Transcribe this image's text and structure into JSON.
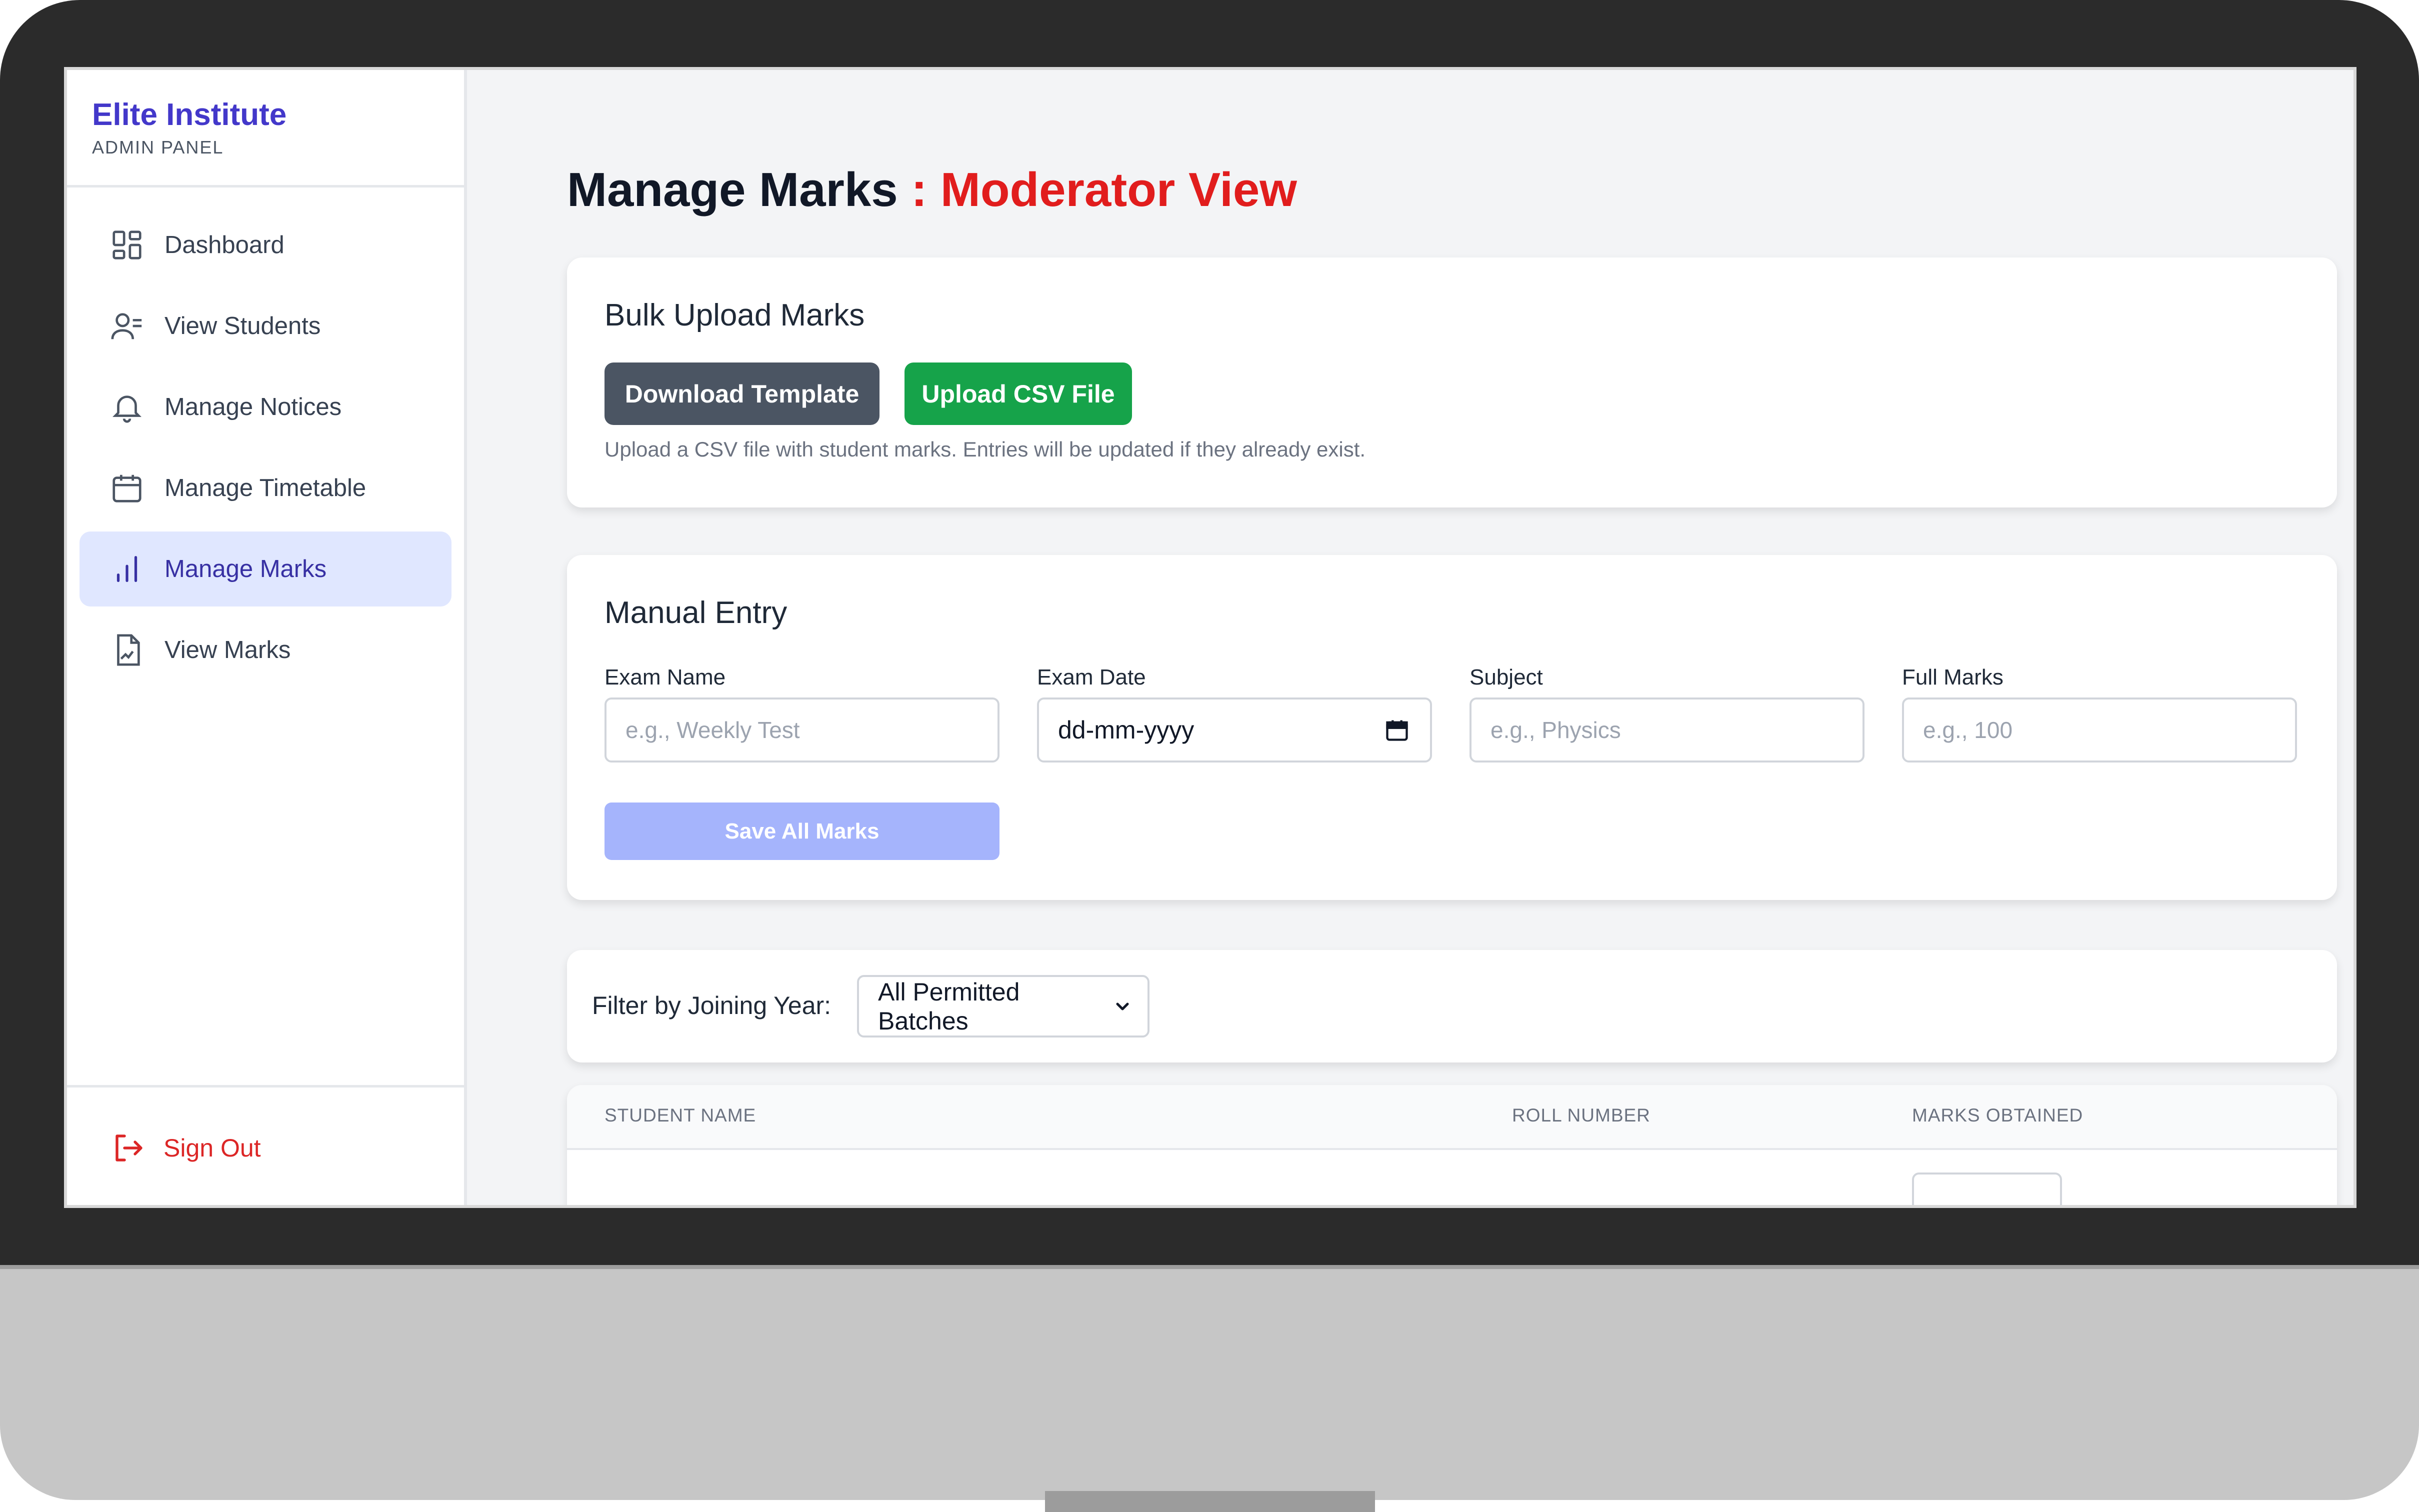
{
  "sidebar": {
    "brand_title": "Elite Institute",
    "brand_subtitle": "ADMIN PANEL",
    "items": [
      {
        "label": "Dashboard",
        "icon": "dashboard-grid-icon"
      },
      {
        "label": "View Students",
        "icon": "user-list-icon"
      },
      {
        "label": "Manage Notices",
        "icon": "bell-icon"
      },
      {
        "label": "Manage Timetable",
        "icon": "calendar-icon"
      },
      {
        "label": "Manage Marks",
        "icon": "bar-chart-icon",
        "active": true
      },
      {
        "label": "View Marks",
        "icon": "document-chart-icon"
      }
    ],
    "signout_label": "Sign Out"
  },
  "page": {
    "title": "Manage Marks",
    "title_accent": ": Moderator View"
  },
  "bulk_upload": {
    "heading": "Bulk Upload Marks",
    "download_label": "Download Template",
    "upload_label": "Upload CSV File",
    "hint": "Upload a CSV file with student marks. Entries will be updated if they already exist."
  },
  "manual_entry": {
    "heading": "Manual Entry",
    "fields": [
      {
        "label": "Exam Name",
        "placeholder": "e.g., Weekly Test"
      },
      {
        "label": "Exam Date",
        "value": "dd-mm-yyyy"
      },
      {
        "label": "Subject",
        "placeholder": "e.g., Physics"
      },
      {
        "label": "Full Marks",
        "placeholder": "e.g., 100"
      }
    ],
    "save_label": "Save All Marks"
  },
  "filter": {
    "label": "Filter by Joining Year:",
    "selected": "All Permitted Batches"
  },
  "table": {
    "columns": [
      "STUDENT NAME",
      "ROLL NUMBER",
      "MARKS OBTAINED"
    ]
  },
  "colors": {
    "brand": "#4338ca",
    "accent_red": "#e11d1d",
    "active_nav_bg": "#e0e7ff",
    "dark_button": "#4b5563",
    "green_button": "#16a34a",
    "save_button_disabled": "#a5b4fc"
  }
}
